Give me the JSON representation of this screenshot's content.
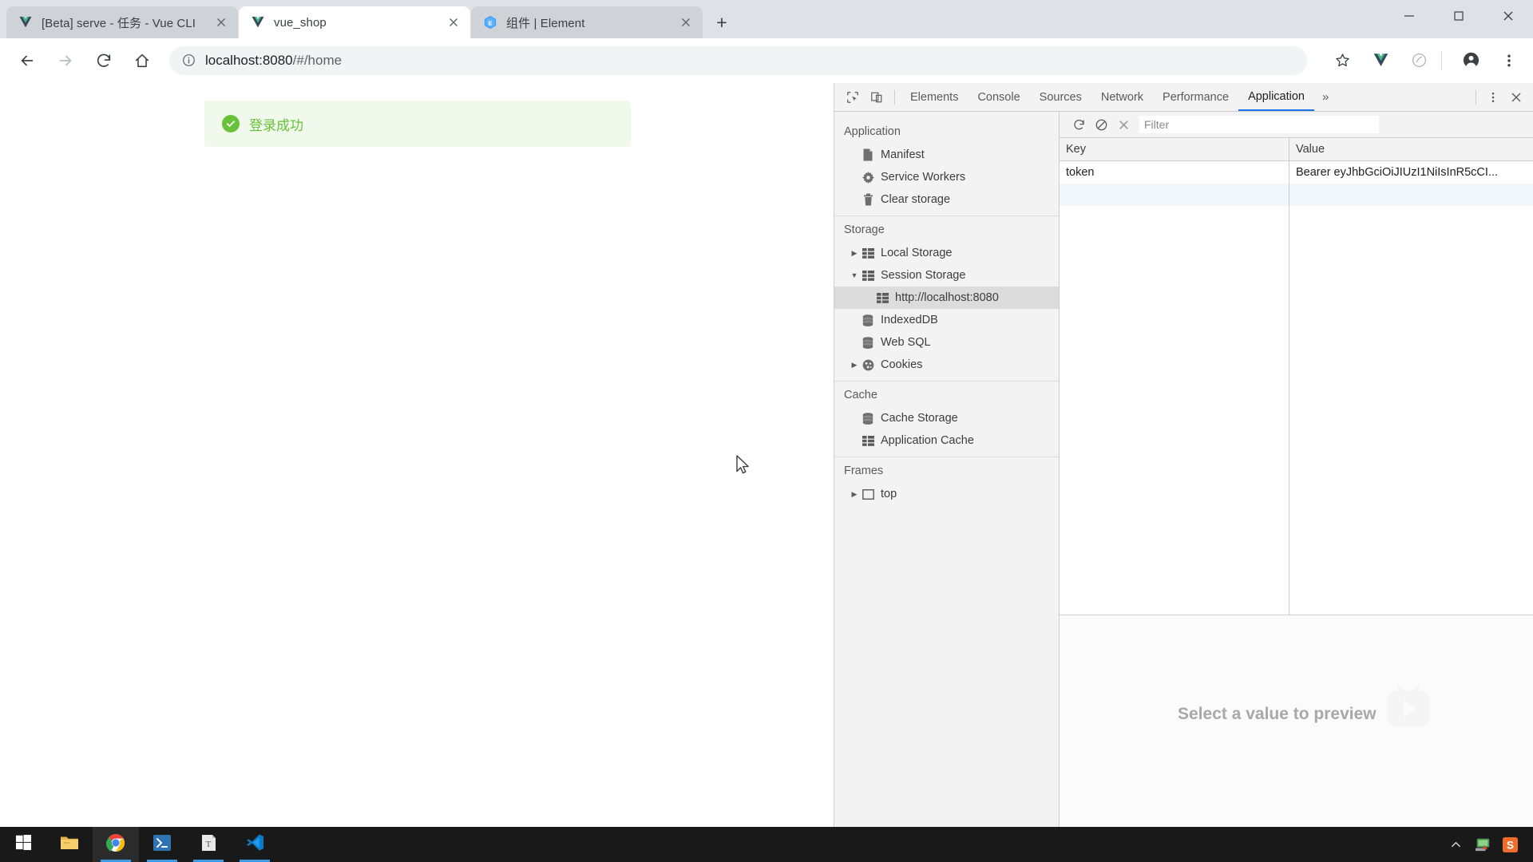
{
  "browser": {
    "tabs": [
      {
        "title": "[Beta] serve - 任务 - Vue CLI",
        "favicon": "vue-logo-icon",
        "active": false,
        "close_label": "✕"
      },
      {
        "title": "vue_shop",
        "favicon": "vue-logo-icon",
        "active": true,
        "close_label": "✕"
      },
      {
        "title": "组件 | Element",
        "favicon": "element-logo-icon",
        "active": false,
        "close_label": "✕"
      }
    ],
    "new_tab_label": "+",
    "window_controls": {
      "minimize": "—",
      "maximize": "❐",
      "close": "✕"
    },
    "toolbar": {
      "back_icon": "back-arrow-icon",
      "forward_icon": "forward-arrow-icon",
      "reload_icon": "reload-icon",
      "home_icon": "home-icon",
      "info_icon": "site-info-icon",
      "url_host": "localhost:8080",
      "url_path": "/#/home",
      "url_full": "localhost:8080/#/home",
      "bookmark_icon": "star-icon",
      "vue_devtools_icon": "vue-extension-icon",
      "extension_icon": "extension-icon",
      "profile_icon": "profile-avatar-icon",
      "menu_icon": "three-dot-menu-icon"
    }
  },
  "page": {
    "alert": {
      "icon": "success-check-icon",
      "text": "登录成功",
      "background": "#f0f9eb",
      "accent": "#67c23a"
    }
  },
  "devtools": {
    "inspect_icon": "inspect-element-icon",
    "device_toggle_icon": "device-toolbar-icon",
    "tabs": [
      {
        "label": "Elements",
        "selected": false
      },
      {
        "label": "Console",
        "selected": false
      },
      {
        "label": "Sources",
        "selected": false
      },
      {
        "label": "Network",
        "selected": false
      },
      {
        "label": "Performance",
        "selected": false
      },
      {
        "label": "Application",
        "selected": true
      }
    ],
    "overflow_label": "»",
    "more_icon": "vertical-dots-icon",
    "close_icon": "close-devtools-icon",
    "selected_tab_accent": "#1a73e8",
    "sidebar": {
      "groups": [
        {
          "title": "Application",
          "items": [
            {
              "label": "Manifest",
              "icon": "manifest-file-icon",
              "indent": 1,
              "twisty": "none",
              "selected": false
            },
            {
              "label": "Service Workers",
              "icon": "gear-icon",
              "indent": 1,
              "twisty": "none",
              "selected": false
            },
            {
              "label": "Clear storage",
              "icon": "trash-icon",
              "indent": 1,
              "twisty": "none",
              "selected": false
            }
          ]
        },
        {
          "title": "Storage",
          "items": [
            {
              "label": "Local Storage",
              "icon": "table-grid-icon",
              "indent": 1,
              "twisty": "collapsed",
              "selected": false
            },
            {
              "label": "Session Storage",
              "icon": "table-grid-icon",
              "indent": 1,
              "twisty": "expanded",
              "selected": false
            },
            {
              "label": "http://localhost:8080",
              "icon": "table-grid-icon",
              "indent": 2,
              "twisty": "none",
              "selected": true
            },
            {
              "label": "IndexedDB",
              "icon": "database-icon",
              "indent": 1,
              "twisty": "none",
              "selected": false
            },
            {
              "label": "Web SQL",
              "icon": "database-icon",
              "indent": 1,
              "twisty": "none",
              "selected": false
            },
            {
              "label": "Cookies",
              "icon": "cookie-icon",
              "indent": 1,
              "twisty": "collapsed",
              "selected": false
            }
          ]
        },
        {
          "title": "Cache",
          "items": [
            {
              "label": "Cache Storage",
              "icon": "database-icon",
              "indent": 1,
              "twisty": "none",
              "selected": false
            },
            {
              "label": "Application Cache",
              "icon": "table-grid-icon",
              "indent": 1,
              "twisty": "none",
              "selected": false
            }
          ]
        },
        {
          "title": "Frames",
          "items": [
            {
              "label": "top",
              "icon": "frame-icon",
              "indent": 1,
              "twisty": "collapsed",
              "selected": false
            }
          ]
        }
      ]
    },
    "storage_panel": {
      "toolbar": {
        "refresh_icon": "refresh-icon",
        "clear_all_icon": "clear-all-icon",
        "delete_selected_icon": "delete-selected-icon",
        "filter_placeholder": "Filter",
        "filter_value": ""
      },
      "columns": [
        "Key",
        "Value"
      ],
      "rows": [
        {
          "key": "token",
          "value": "Bearer eyJhbGciOiJIUzI1NiIsInR5cCI..."
        }
      ],
      "preview": {
        "message": "Select a value to preview",
        "watermark_icon": "tv-play-watermark-icon"
      }
    }
  },
  "taskbar": {
    "items": [
      {
        "name": "start-button",
        "icon": "windows-logo-icon",
        "active": false,
        "running": false
      },
      {
        "name": "file-explorer",
        "icon": "folder-icon",
        "active": false,
        "running": false
      },
      {
        "name": "chrome",
        "icon": "chrome-icon",
        "active": true,
        "running": true
      },
      {
        "name": "powershell",
        "icon": "powershell-icon",
        "active": false,
        "running": true
      },
      {
        "name": "typora",
        "icon": "typora-icon",
        "active": false,
        "running": true
      },
      {
        "name": "vscode",
        "icon": "vscode-icon",
        "active": false,
        "running": true
      }
    ],
    "tray": [
      {
        "name": "show-hidden-icons",
        "icon": "chevron-up-icon"
      },
      {
        "name": "network-icon",
        "icon": "network-monitor-icon"
      },
      {
        "name": "sogou-input",
        "icon": "sogou-icon"
      }
    ]
  }
}
